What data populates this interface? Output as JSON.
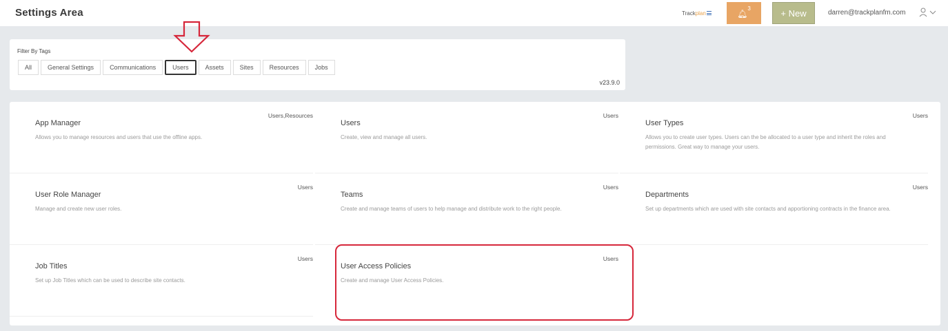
{
  "header": {
    "title": "Settings Area",
    "brand": {
      "name": "Trackplan",
      "part1": "Track",
      "part2": "plan"
    },
    "notifications": {
      "count": "3",
      "icon": "bell-icon"
    },
    "new_button": "+ New",
    "user_email": "darren@trackplanfm.com",
    "user_icon": "user-icon"
  },
  "filter": {
    "label": "Filter By Tags",
    "tags": [
      "All",
      "General Settings",
      "Communications",
      "Users",
      "Assets",
      "Sites",
      "Resources",
      "Jobs"
    ],
    "active_tag": "Users",
    "version": "v23.9.0"
  },
  "cards": [
    {
      "title": "App Manager",
      "tags": "Users,Resources",
      "description": "Allows you to manage resources and users that use the offline apps."
    },
    {
      "title": "Users",
      "tags": "Users",
      "description": "Create, view and manage all users."
    },
    {
      "title": "User Types",
      "tags": "Users",
      "description": "Allows you to create user types. Users can the be allocated to a user type and inherit the roles and permissions. Great way to manage your users."
    },
    {
      "title": "User Role Manager",
      "tags": "Users",
      "description": "Manage and create new user roles."
    },
    {
      "title": "Teams",
      "tags": "Users",
      "description": "Create and manage teams of users to help manage and distribute work to the right people."
    },
    {
      "title": "Departments",
      "tags": "Users",
      "description": "Set up departments which are used with site contacts and apportioning contracts in the finance area."
    },
    {
      "title": "Job Titles",
      "tags": "Users",
      "description": "Set up Job Titles which can be used to describe site contacts."
    },
    {
      "title": "User Access Policies",
      "tags": "Users",
      "description": "Create and manage User Access Policies."
    }
  ],
  "colors": {
    "accent_orange": "#e8a564",
    "new_button": "#b8bc8c",
    "highlight_red": "#d6263a",
    "background": "#e6e9ec"
  }
}
